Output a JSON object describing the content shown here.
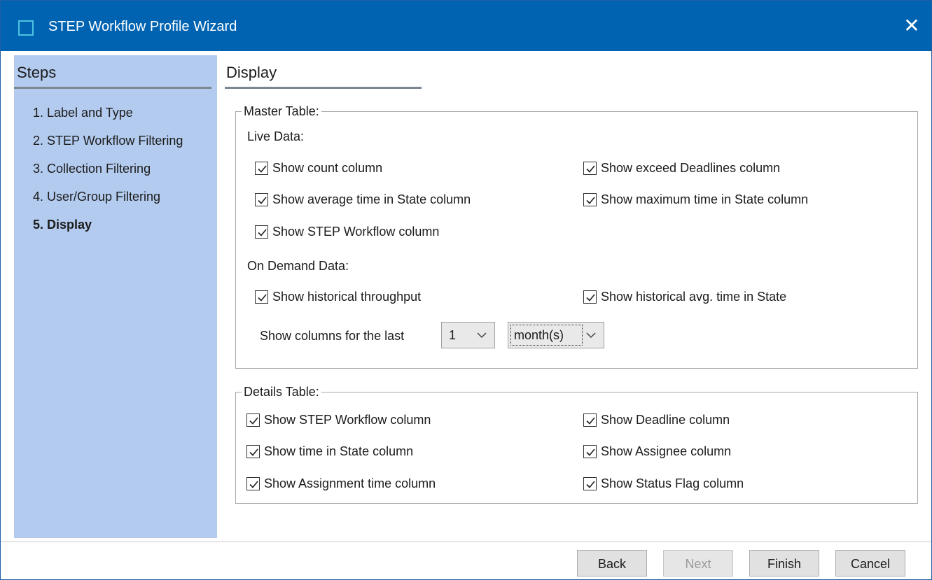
{
  "window": {
    "title": "STEP Workflow Profile Wizard",
    "close_glyph": "✕"
  },
  "steps": {
    "header": "Steps",
    "items": [
      {
        "label": "1. Label and Type",
        "active": false
      },
      {
        "label": "2. STEP Workflow Filtering",
        "active": false
      },
      {
        "label": "3. Collection Filtering",
        "active": false
      },
      {
        "label": "4. User/Group Filtering",
        "active": false
      },
      {
        "label": "5. Display",
        "active": true
      }
    ]
  },
  "page": {
    "title": "Display"
  },
  "master_table": {
    "legend": "Master Table:",
    "live_data_label": "Live Data:",
    "live": {
      "show_count": {
        "label": "Show count column",
        "checked": true
      },
      "show_exceed_deadlines": {
        "label": "Show exceed Deadlines column",
        "checked": true
      },
      "show_avg_time": {
        "label": "Show average time in State column",
        "checked": true
      },
      "show_max_time": {
        "label": "Show maximum time in State column",
        "checked": true
      },
      "show_workflow": {
        "label": "Show STEP Workflow column",
        "checked": true
      }
    },
    "on_demand_label": "On Demand Data:",
    "on_demand": {
      "show_hist_throughput": {
        "label": "Show historical throughput",
        "checked": true
      },
      "show_hist_avg_time": {
        "label": "Show historical avg. time in State",
        "checked": true
      }
    },
    "period": {
      "label": "Show columns for the last",
      "count": "1",
      "unit": "month(s)"
    }
  },
  "details_table": {
    "legend": "Details Table:",
    "show_workflow": {
      "label": "Show STEP Workflow column",
      "checked": true
    },
    "show_deadline": {
      "label": "Show Deadline column",
      "checked": true
    },
    "show_time_in_state": {
      "label": "Show time in State column",
      "checked": true
    },
    "show_assignee": {
      "label": "Show Assignee column",
      "checked": true
    },
    "show_assignment_time": {
      "label": "Show Assignment time column",
      "checked": true
    },
    "show_status_flag": {
      "label": "Show Status Flag column",
      "checked": true
    }
  },
  "buttons": {
    "back": "Back",
    "next": "Next",
    "finish": "Finish",
    "cancel": "Cancel"
  },
  "colors": {
    "titlebar": "#0063b1",
    "sidebar": "#b3cbee"
  }
}
